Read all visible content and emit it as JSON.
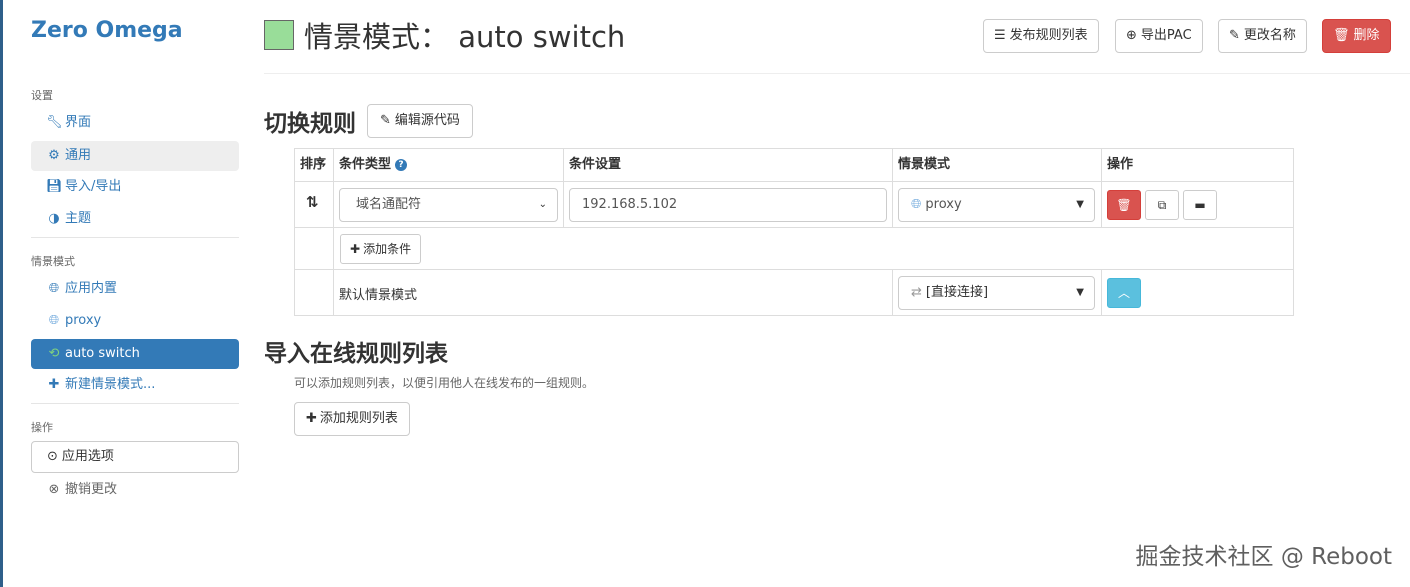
{
  "app": {
    "title": "Zero Omega"
  },
  "sidebar": {
    "settings_header": "设置",
    "settings_items": [
      {
        "label": "界面",
        "icon": "wrench-icon"
      },
      {
        "label": "通用",
        "icon": "gear-icon"
      },
      {
        "label": "导入/导出",
        "icon": "floppy-icon"
      },
      {
        "label": "主题",
        "icon": "contrast-icon"
      }
    ],
    "profiles_header": "情景模式",
    "profile_items": [
      {
        "label": "应用内置",
        "icon": "globe-icon"
      },
      {
        "label": "proxy",
        "icon": "globe-icon"
      },
      {
        "label": "auto switch",
        "icon": "retweet-icon"
      },
      {
        "label": "新建情景模式...",
        "icon": "plus-icon"
      }
    ],
    "actions_header": "操作",
    "apply_label": "应用选项",
    "undo_label": "撤销更改"
  },
  "header": {
    "profile_color": "#99dd99",
    "title": "情景模式： auto switch",
    "buttons": {
      "publish": "发布规则列表",
      "export_pac": "导出PAC",
      "rename": "更改名称",
      "delete": "删除"
    }
  },
  "rules_section": {
    "title": "切换规则",
    "edit_source": "编辑源代码",
    "columns": {
      "sort": "排序",
      "condition_type": "条件类型",
      "condition": "条件设置",
      "profile": "情景模式",
      "actions": "操作"
    },
    "rules": [
      {
        "condition_type": "域名通配符",
        "condition": "192.168.5.102",
        "profile": "proxy"
      }
    ],
    "add_condition": "添加条件",
    "default_label": "默认情景模式",
    "default_profile": "[直接连接]"
  },
  "online_section": {
    "title": "导入在线规则列表",
    "help": "可以添加规则列表，以便引用他人在线发布的一组规则。",
    "add_button": "添加规则列表"
  },
  "watermark": "掘金技术社区 @ Reboot"
}
